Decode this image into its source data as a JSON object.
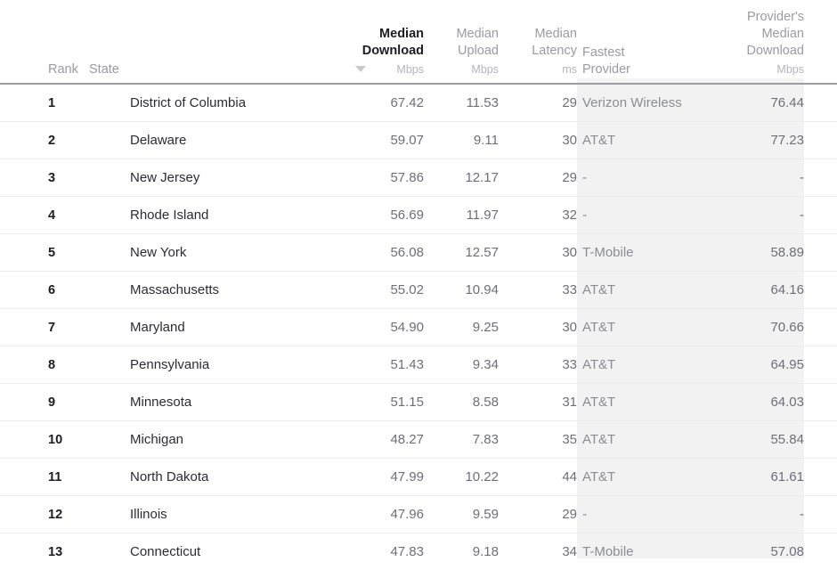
{
  "table": {
    "sort": {
      "active_column": "Median Download",
      "direction": "descending",
      "caret_icon": "sort-descending-caret-icon"
    },
    "columns": [
      {
        "key": "rank",
        "label": "Rank",
        "unit": "",
        "align": "left"
      },
      {
        "key": "state",
        "label": "State",
        "unit": "",
        "align": "left"
      },
      {
        "key": "download",
        "label": "Median Download",
        "line1": "Median",
        "line2": "Download",
        "unit": "Mbps",
        "align": "right",
        "active": true
      },
      {
        "key": "upload",
        "label": "Median Upload",
        "line1": "Median",
        "line2": "Upload",
        "unit": "Mbps",
        "align": "right",
        "active": false
      },
      {
        "key": "latency",
        "label": "Median Latency",
        "line1": "Median",
        "line2": "Latency",
        "unit": "ms",
        "align": "right",
        "active": false
      },
      {
        "key": "provider",
        "label": "Fastest Provider",
        "line1": "Fastest",
        "line2": "Provider",
        "unit": "",
        "align": "left",
        "active": false
      },
      {
        "key": "prov_dl",
        "label": "Provider's Median Download",
        "line1": "Provider's",
        "line2": "Median",
        "line3": "Download",
        "unit": "Mbps",
        "align": "right",
        "active": false
      }
    ],
    "rows": [
      {
        "rank": "1",
        "state": "District of Columbia",
        "download": "67.42",
        "upload": "11.53",
        "latency": "29",
        "provider": "Verizon Wireless",
        "provider_download": "76.44"
      },
      {
        "rank": "2",
        "state": "Delaware",
        "download": "59.07",
        "upload": "9.11",
        "latency": "30",
        "provider": "AT&T",
        "provider_download": "77.23"
      },
      {
        "rank": "3",
        "state": "New Jersey",
        "download": "57.86",
        "upload": "12.17",
        "latency": "29",
        "provider": "-",
        "provider_download": "-"
      },
      {
        "rank": "4",
        "state": "Rhode Island",
        "download": "56.69",
        "upload": "11.97",
        "latency": "32",
        "provider": "-",
        "provider_download": "-"
      },
      {
        "rank": "5",
        "state": "New York",
        "download": "56.08",
        "upload": "12.57",
        "latency": "30",
        "provider": "T-Mobile",
        "provider_download": "58.89"
      },
      {
        "rank": "6",
        "state": "Massachusetts",
        "download": "55.02",
        "upload": "10.94",
        "latency": "33",
        "provider": "AT&T",
        "provider_download": "64.16"
      },
      {
        "rank": "7",
        "state": "Maryland",
        "download": "54.90",
        "upload": "9.25",
        "latency": "30",
        "provider": "AT&T",
        "provider_download": "70.66"
      },
      {
        "rank": "8",
        "state": "Pennsylvania",
        "download": "51.43",
        "upload": "9.34",
        "latency": "33",
        "provider": "AT&T",
        "provider_download": "64.95"
      },
      {
        "rank": "9",
        "state": "Minnesota",
        "download": "51.15",
        "upload": "8.58",
        "latency": "31",
        "provider": "AT&T",
        "provider_download": "64.03"
      },
      {
        "rank": "10",
        "state": "Michigan",
        "download": "48.27",
        "upload": "7.83",
        "latency": "35",
        "provider": "AT&T",
        "provider_download": "55.84"
      },
      {
        "rank": "11",
        "state": "North Dakota",
        "download": "47.99",
        "upload": "10.22",
        "latency": "44",
        "provider": "AT&T",
        "provider_download": "61.61"
      },
      {
        "rank": "12",
        "state": "Illinois",
        "download": "47.96",
        "upload": "9.59",
        "latency": "29",
        "provider": "-",
        "provider_download": "-"
      },
      {
        "rank": "13",
        "state": "Connecticut",
        "download": "47.83",
        "upload": "9.18",
        "latency": "34",
        "provider": "T-Mobile",
        "provider_download": "57.08"
      }
    ]
  },
  "colors": {
    "highlight_band": "#f2f2f3",
    "header_rule": "#9c9ca4",
    "row_rule": "#ececee",
    "muted_text": "#9a9aa2",
    "value_text": "#6e6e7a",
    "strong_text": "#1c1c22"
  }
}
